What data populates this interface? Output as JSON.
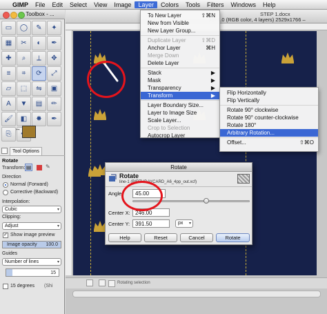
{
  "menubar": {
    "apple_glyph": "",
    "app_name": "GIMP",
    "items": [
      "File",
      "Edit",
      "Select",
      "View",
      "Image",
      "Layer",
      "Colors",
      "Tools",
      "Filters",
      "Windows",
      "Help"
    ],
    "active_item": "Layer"
  },
  "toolbox": {
    "title": "Toolbox - ...",
    "tools": [
      "rect-select",
      "ellipse-select",
      "free-select",
      "fuzzy-select",
      "color-select",
      "scissors",
      "foreground-select",
      "paths",
      "color-picker",
      "zoom",
      "measure",
      "move",
      "align",
      "crop",
      "rotate",
      "scale",
      "shear",
      "perspective",
      "flip",
      "cage",
      "text",
      "bucket-fill",
      "blend",
      "pencil",
      "paintbrush",
      "eraser",
      "airbrush",
      "ink",
      "clone",
      "heal"
    ],
    "selected_tool_index": 14,
    "fg_color": "#a07a2b",
    "bg_color": "#ffffff"
  },
  "tool_options": {
    "tab_label": "Tool Options",
    "title": "Rotate",
    "transform_label": "Transform:",
    "direction_label": "Direction",
    "direction_options": [
      "Normal (Forward)",
      "Corrective (Backward)"
    ],
    "direction_selected": "Normal (Forward)",
    "interpolation_label": "Interpolation:",
    "interpolation_value": "Cubic",
    "clipping_label": "Clipping:",
    "clipping_value": "Adjust",
    "show_preview_label": "Show image preview",
    "show_preview_checked": true,
    "opacity_label": "Image opacity",
    "opacity_value": "100.0",
    "guides_label": "Guides",
    "guides_value": "Number of lines",
    "lines_value": "15",
    "degrees_label": "15 degrees",
    "degrees_suffix": "(Shi"
  },
  "image_window": {
    "title_partial": "xcf-1.0 (RGB color, 4 layers) 2529x1766 –",
    "title_file": "STEP 1.docx",
    "status_text": "Rotating selection",
    "canvas_color": "#16214a",
    "crown_color": "#caa238"
  },
  "layer_menu": {
    "items": [
      {
        "label": "To New Layer",
        "shortcut": "⇧⌘N",
        "disabled": false
      },
      {
        "label": "New from Visible",
        "shortcut": "",
        "disabled": false
      },
      {
        "label": "New Layer Group...",
        "shortcut": "",
        "disabled": false
      },
      {
        "label": "Duplicate Layer",
        "shortcut": "⇧⌘D",
        "disabled": true
      },
      {
        "label": "Anchor Layer",
        "shortcut": "⌘H",
        "disabled": false
      },
      {
        "label": "Merge Down",
        "shortcut": "",
        "disabled": true
      },
      {
        "label": "Delete Layer",
        "shortcut": "",
        "disabled": false
      },
      {
        "label": "Stack",
        "shortcut": "▶",
        "disabled": false
      },
      {
        "label": "Mask",
        "shortcut": "▶",
        "disabled": false
      },
      {
        "label": "Transparency",
        "shortcut": "▶",
        "disabled": false
      },
      {
        "label": "Transform",
        "shortcut": "▶",
        "disabled": false,
        "highlighted": true
      },
      {
        "label": "Layer Boundary Size...",
        "shortcut": "",
        "disabled": false
      },
      {
        "label": "Layer to Image Size",
        "shortcut": "",
        "disabled": false
      },
      {
        "label": "Scale Layer...",
        "shortcut": "",
        "disabled": false
      },
      {
        "label": "Crop to Selection",
        "shortcut": "",
        "disabled": true
      },
      {
        "label": "Autocrop Layer",
        "shortcut": "",
        "disabled": false
      }
    ]
  },
  "transform_submenu": {
    "items": [
      {
        "label": "Flip Horizontally",
        "shortcut": ""
      },
      {
        "label": "Flip Vertically",
        "shortcut": ""
      },
      {
        "label": "Rotate 90° clockwise",
        "shortcut": ""
      },
      {
        "label": "Rotate 90° counter-clockwise",
        "shortcut": ""
      },
      {
        "label": "Rotate 180°",
        "shortcut": ""
      },
      {
        "label": "Arbitrary Rotation...",
        "shortcut": "",
        "highlighted": true
      },
      {
        "label": "Offset...",
        "shortcut": "⇧⌘O"
      }
    ]
  },
  "rotate_dialog": {
    "window_title": "Rotate",
    "heading": "Rotate",
    "subheading": "line-1 (BIRTHDAYCARD_A6_4pp_out.xcf)",
    "angle_label": "Angle:",
    "angle_value": "45.00",
    "angle_slider_fraction": 0.625,
    "center_x_label": "Center X:",
    "center_x_value": "246.00",
    "center_y_label": "Center Y:",
    "center_y_value": "391.50",
    "unit_value": "px",
    "buttons": {
      "help": "Help",
      "reset": "Reset",
      "cancel": "Cancel",
      "rotate": "Rotate"
    }
  },
  "annotation_color": "#e4141c"
}
